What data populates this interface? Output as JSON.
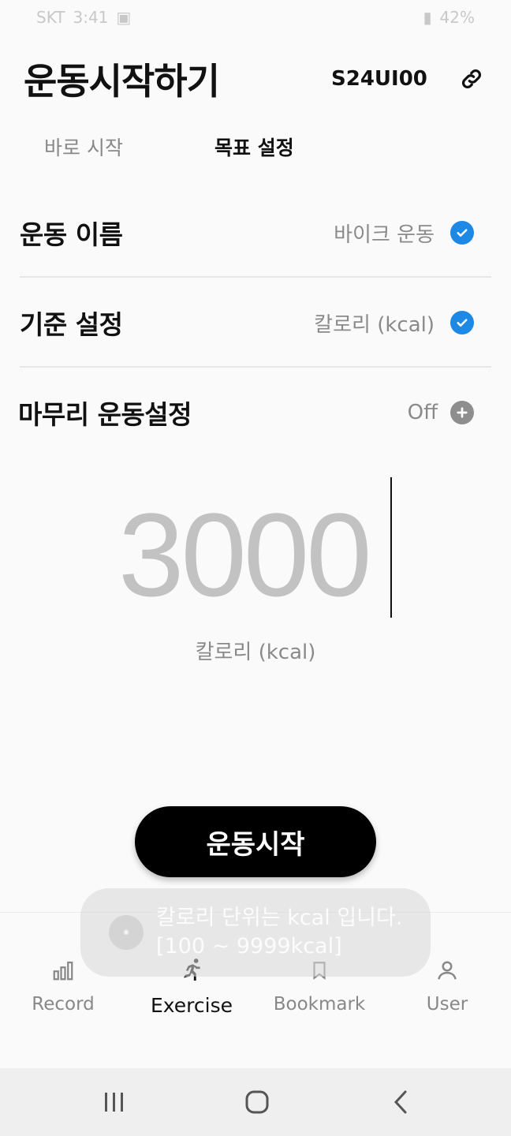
{
  "status_bar": {
    "carrier": "SKT",
    "time": "3:41",
    "battery": "42%"
  },
  "header": {
    "title": "운동시작하기",
    "device_id": "S24UI00",
    "link_icon": "link-icon"
  },
  "tabs": [
    {
      "label": "바로 시작",
      "active": false
    },
    {
      "label": "목표 설정",
      "active": true
    }
  ],
  "settings": {
    "exercise_name": {
      "label": "운동 이름",
      "value": "바이크 운동",
      "icon": "check-circle-icon"
    },
    "criteria": {
      "label": "기준 설정",
      "value": "칼로리 (kcal)",
      "icon": "check-circle-icon"
    },
    "cooldown": {
      "label": "마무리 운동설정",
      "value": "Off",
      "icon": "plus-circle-icon"
    }
  },
  "goal": {
    "value": "3000",
    "unit": "칼로리 (kcal)"
  },
  "start_button": {
    "label": "운동시작"
  },
  "toast": {
    "line1": "칼로리 단위는 kcal 입니다.",
    "line2": "[100 ~ 9999kcal]"
  },
  "bottom_nav": [
    {
      "label": "Record",
      "icon": "bar-chart-icon",
      "active": false
    },
    {
      "label": "Exercise",
      "icon": "running-icon",
      "active": true
    },
    {
      "label": "Bookmark",
      "icon": "bookmark-icon",
      "active": false
    },
    {
      "label": "User",
      "icon": "user-icon",
      "active": false
    }
  ],
  "colors": {
    "accent": "#1e88e5",
    "primary_button": "#000000",
    "value_gray": "#c2c2c2"
  }
}
